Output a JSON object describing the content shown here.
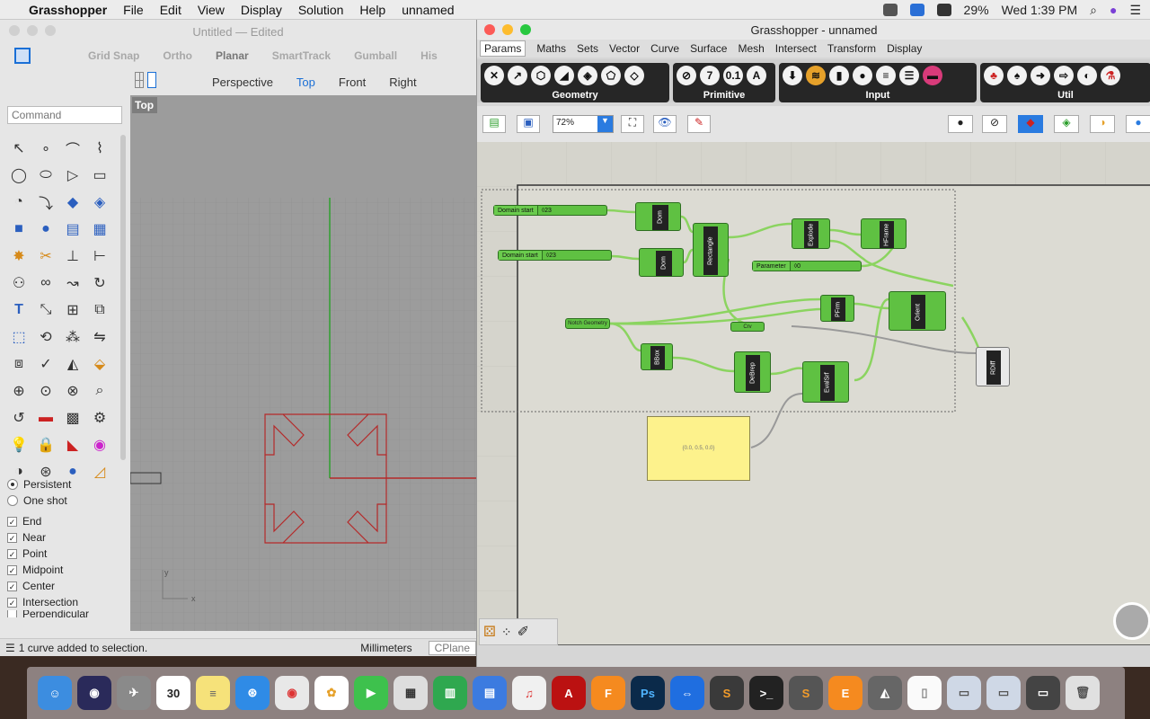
{
  "menubar": {
    "app": "Grasshopper",
    "items": [
      "File",
      "Edit",
      "View",
      "Display",
      "Solution",
      "Help",
      "unnamed"
    ],
    "battery": "29%",
    "clock": "Wed 1:39 PM"
  },
  "rhino": {
    "title": "Untitled — Edited",
    "toolbar": [
      "Grid Snap",
      "Ortho",
      "Planar",
      "SmartTrack",
      "Gumball",
      "His"
    ],
    "view_tabs": [
      "Perspective",
      "Top",
      "Front",
      "Right"
    ],
    "active_view": "Top",
    "command_placeholder": "Command",
    "viewport_label": "Top",
    "osnap_mode": [
      "Persistent",
      "One shot"
    ],
    "osnaps": [
      {
        "label": "End",
        "checked": true
      },
      {
        "label": "Near",
        "checked": true
      },
      {
        "label": "Point",
        "checked": true
      },
      {
        "label": "Midpoint",
        "checked": true
      },
      {
        "label": "Center",
        "checked": true
      },
      {
        "label": "Intersection",
        "checked": true
      },
      {
        "label": "Perpendicular",
        "checked": false
      }
    ],
    "status": "1 curve added to selection.",
    "units": "Millimeters",
    "cplane": "CPlane"
  },
  "grasshopper": {
    "title": "Grasshopper - unnamed",
    "tabs": [
      "Params",
      "Maths",
      "Sets",
      "Vector",
      "Curve",
      "Surface",
      "Mesh",
      "Intersect",
      "Transform",
      "Display"
    ],
    "active_tab": "Params",
    "groups": [
      "Geometry",
      "Primitive",
      "Input",
      "Util"
    ],
    "zoom": "72%",
    "sliders": [
      {
        "name": "Domain start",
        "value": "◊23"
      },
      {
        "name": "Domain start",
        "value": "◊23"
      },
      {
        "name": "Parameter",
        "value": "◊0"
      }
    ],
    "nodes": {
      "dom1": "Dom",
      "dom2": "Dom",
      "rect": "Rectangle",
      "explode": "Explode",
      "hframe": "HFrame",
      "pfrm": "PFrm",
      "orient": "Orient",
      "bbox": "BBox",
      "debrep": "DeBrep",
      "evalsrf": "EvalSrf",
      "rdiff": "RDiff"
    },
    "params": {
      "notch": "Notch Geometry",
      "crv": "Crv"
    },
    "panel_text": "{0.0, 0.5, 0.0}"
  },
  "colors": {
    "accent": "#1a6fd6",
    "node": "#5fc142",
    "wire": "#8bd460",
    "panel": "#fdf28c",
    "red_curve": "#b52a2a"
  }
}
